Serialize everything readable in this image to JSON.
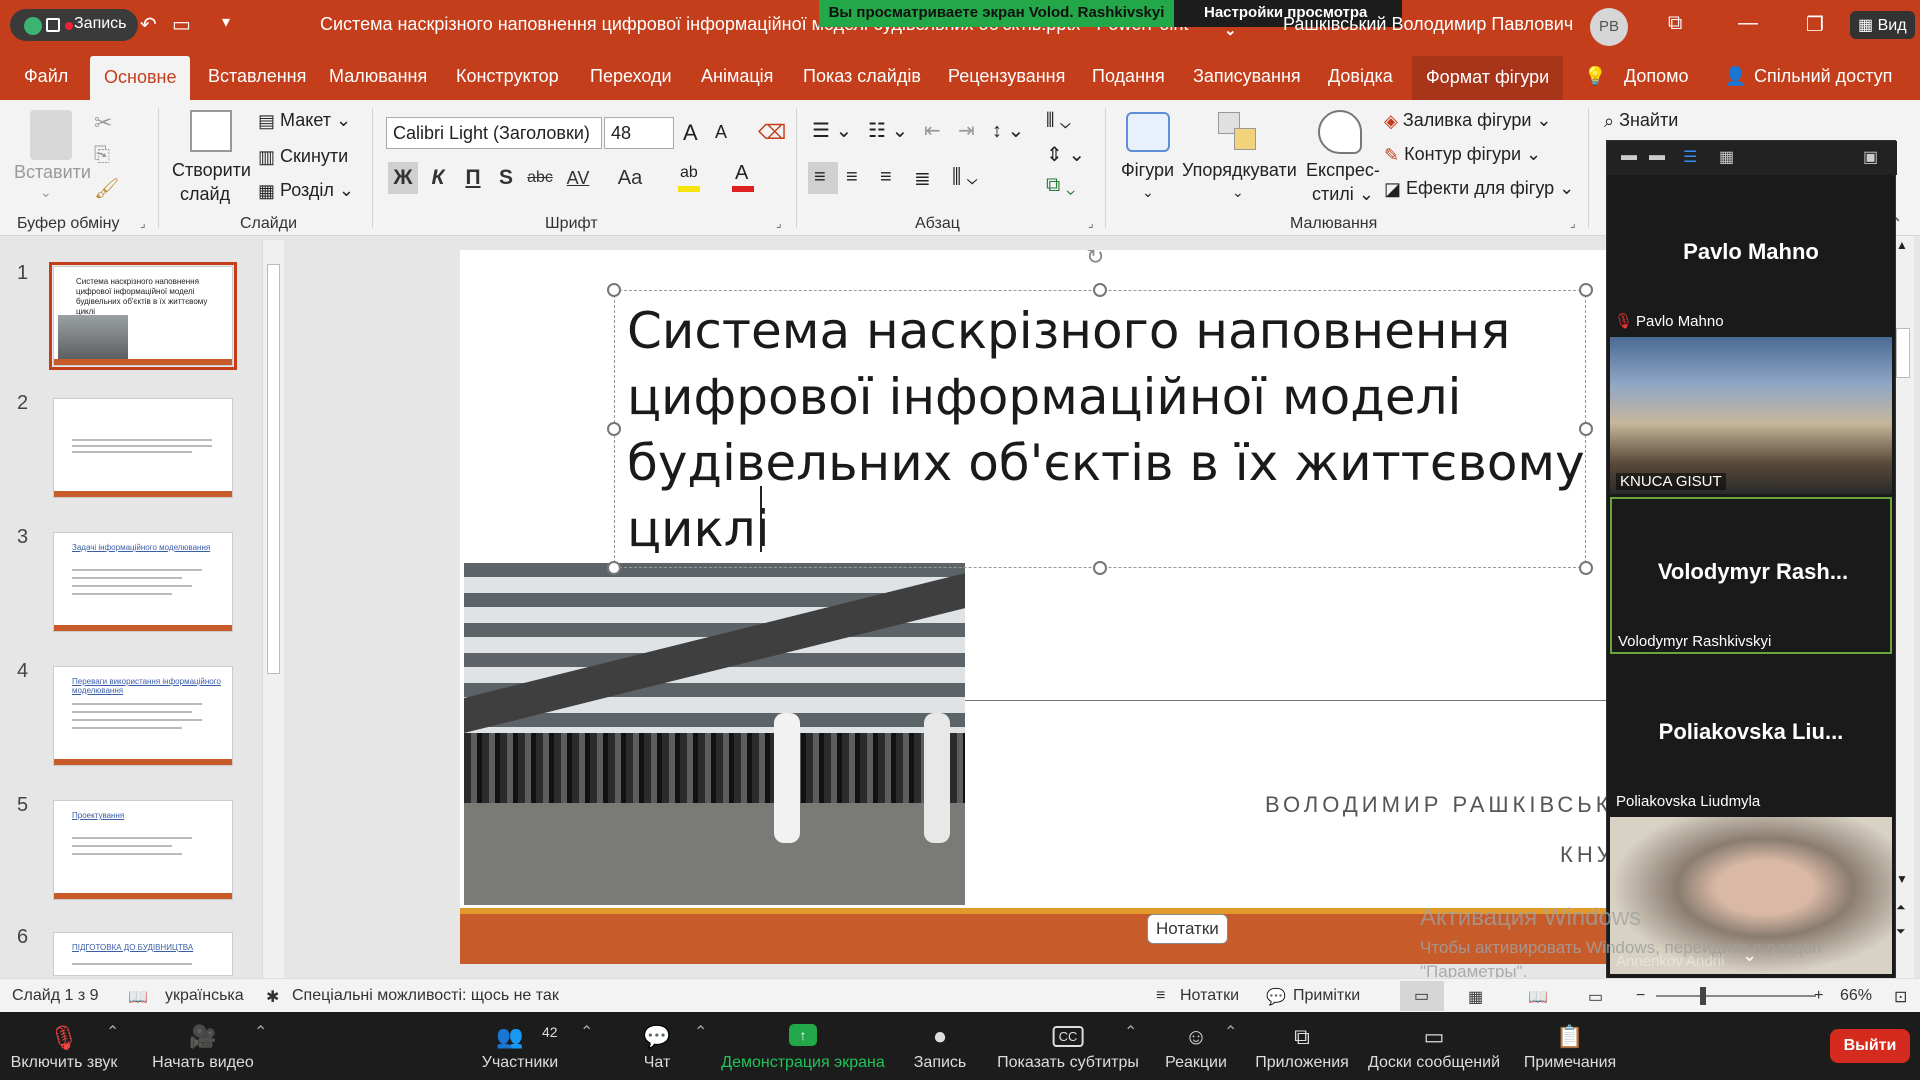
{
  "titlebar": {
    "record_label": "Запись",
    "share_banner": "Вы просматриваете экран Volod. Rashkivskyi",
    "view_options": "Настройки просмотра",
    "doc_title": "Система наскрізного наповнення цифрової інформаційної моделі будівельних об'єктів.pptx - PowerPoint",
    "user_name": "Рашківський Володимир Павлович",
    "avatar_initials": "РВ",
    "view_button": "Вид"
  },
  "tabs": [
    "Файл",
    "Основне",
    "Вставлення",
    "Малювання",
    "Конструктор",
    "Переходи",
    "Анімація",
    "Показ слайдів",
    "Рецензування",
    "Подання",
    "Записування",
    "Довідка",
    "Формат фігури"
  ],
  "tabs_right": {
    "help": "Допомо",
    "share": "Спільний доступ"
  },
  "ribbon": {
    "clipboard": {
      "paste": "Вставити",
      "group": "Буфер обміну"
    },
    "slides": {
      "new_slide_1": "Створити",
      "new_slide_2": "слайд",
      "layout": "Макет",
      "reset": "Скинути",
      "section": "Розділ",
      "group": "Слайди"
    },
    "font": {
      "font_name": "Calibri Light (Заголовки)",
      "font_size": "48",
      "group": "Шрифт",
      "bold": "Ж",
      "italic": "К",
      "underline": "П",
      "shadow": "S",
      "strike": "abc",
      "spacing": "AV",
      "case": "Aa"
    },
    "paragraph": {
      "group": "Абзац"
    },
    "drawing": {
      "shapes": "Фігури",
      "arrange": "Упорядкувати",
      "quick_1": "Експрес-",
      "quick_2": "стилі",
      "fill": "Заливка фігури",
      "outline": "Контур фігури",
      "effects": "Ефекти для фігур",
      "group": "Малювання"
    },
    "editing": {
      "find": "Знайти"
    }
  },
  "thumbnails": [
    {
      "num": "1",
      "title": "Система наскрізного наповнення цифрової інформаційної моделі будівельних об'єктів в їх життєвому циклі"
    },
    {
      "num": "2",
      "title": ""
    },
    {
      "num": "3",
      "title": "Задачі інформаційного моделювання"
    },
    {
      "num": "4",
      "title": "Переваги використання інформаційного моделювання"
    },
    {
      "num": "5",
      "title": "Проектування"
    },
    {
      "num": "6",
      "title": "ПІДГОТОВКА ДО БУДІВНИЦТВА"
    }
  ],
  "slide": {
    "title": "Система наскрізного наповнення цифрової інформаційної моделі будівельних об'єктів в їх життєвому циклі",
    "author": "ВОЛОДИМИР РАШКІВСЬКИЙ",
    "org": "КНУ",
    "notes_tip": "Нотатки"
  },
  "zoom_panel": {
    "participants": [
      {
        "display": "Pavlo Mahno",
        "label": "Pavlo Mahno"
      },
      {
        "display": "",
        "label": "KNUCA GISUT"
      },
      {
        "display": "Volodymyr  Rash...",
        "label": "Volodymyr Rashkivskyi"
      },
      {
        "display": "Poliakovska  Liu...",
        "label": "Poliakovska Liudmyla"
      },
      {
        "display": "",
        "label": "Annenkov Andrii"
      }
    ]
  },
  "watermark": {
    "line1": "Активация Windows",
    "line2": "Чтобы активировать Windows, перейдите в раздел \"Параметры\"."
  },
  "statusbar": {
    "slide_pos": "Слайд 1 з 9",
    "language": "українська",
    "accessibility": "Спеціальні можливості: щось не так",
    "notes": "Нотатки",
    "comments": "Примітки",
    "zoom": "66%"
  },
  "zoom_toolbar": {
    "unmute": "Включить звук",
    "start_video": "Начать видео",
    "participants": "Участники",
    "participants_count": "42",
    "chat": "Чат",
    "share_screen": "Демонстрация экрана",
    "record": "Запись",
    "captions": "Показать субтитры",
    "reactions": "Реакции",
    "apps": "Приложения",
    "whiteboards": "Доски сообщений",
    "notes": "Примечания",
    "leave": "Выйти"
  },
  "colors": {
    "accent": "#c43e1c",
    "slide_band": "#c75b2a",
    "slide_band_top": "#e39a2b",
    "share_green": "#23a849",
    "leave_red": "#d52b1e"
  }
}
